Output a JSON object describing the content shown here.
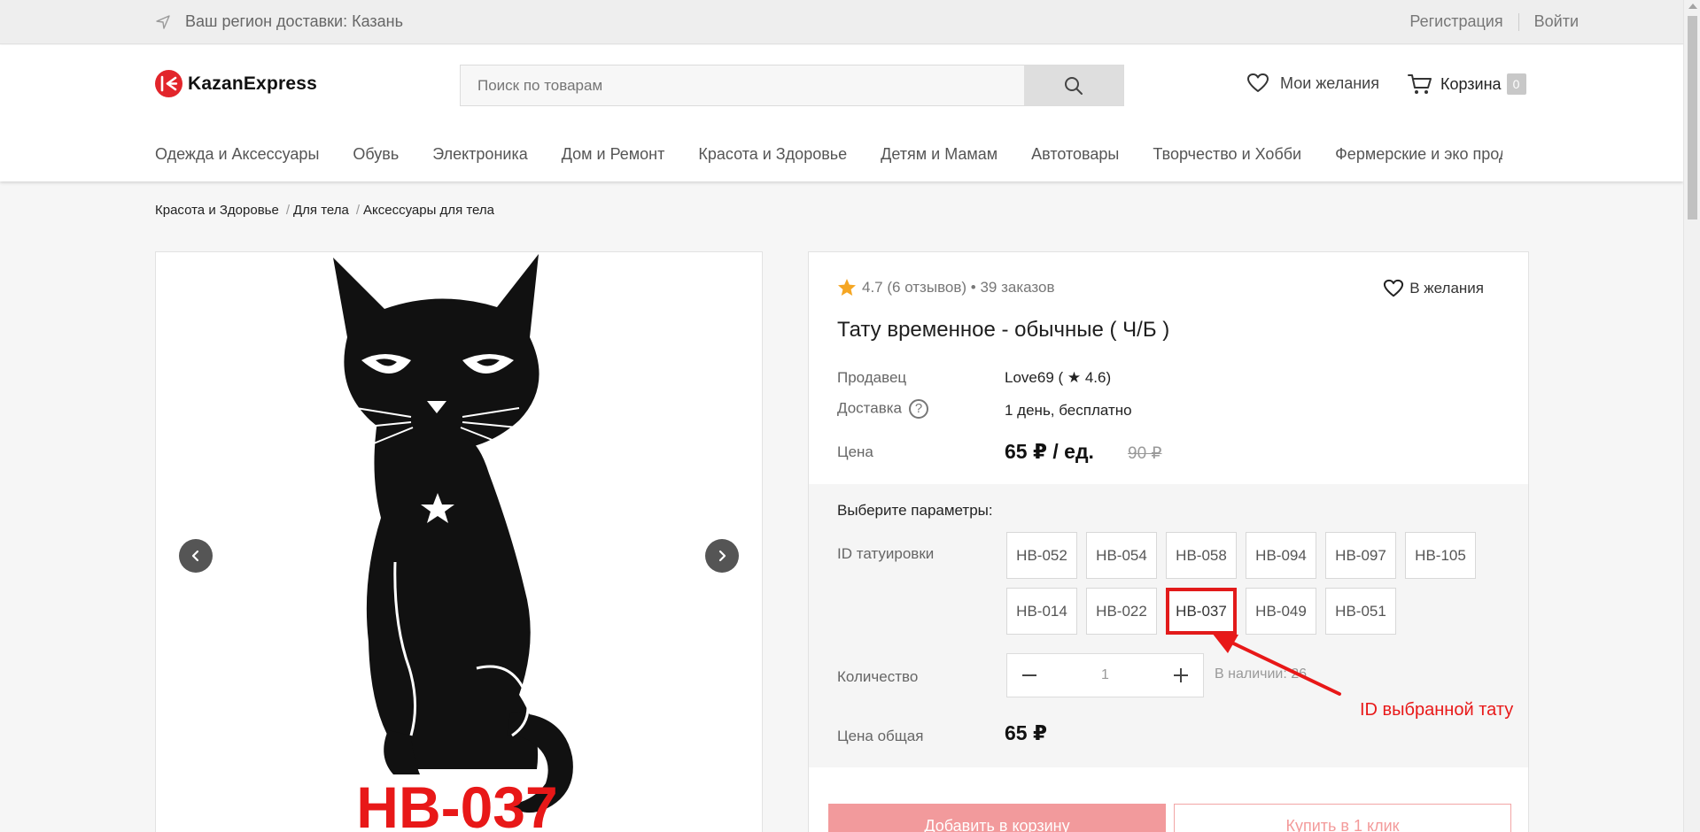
{
  "topbar": {
    "region_text": "Ваш регион доставки: Казань",
    "register": "Регистрация",
    "login": "Войти"
  },
  "header": {
    "logo_text": "KazanExpress",
    "search_placeholder": "Поиск по товарам",
    "wishlist": "Мои желания",
    "cart": "Корзина",
    "cart_count": "0"
  },
  "nav": [
    "Одежда и Аксессуары",
    "Обувь",
    "Электроника",
    "Дом и Ремонт",
    "Красота и Здоровье",
    "Детям и Мамам",
    "Автотовары",
    "Творчество и Хобби",
    "Фермерские и эко проду"
  ],
  "breadcrumb": [
    "Красота и Здоровье",
    "Для тела",
    "Аксессуары для тела"
  ],
  "gallery": {
    "image_caption": "HB-037"
  },
  "product": {
    "rating": "4.7 (6 отзывов) • 39 заказов",
    "wish_button": "В желания",
    "title": "Тату временное - обычные ( Ч/Б )",
    "seller_label": "Продавец",
    "seller_value": "Love69 ( ★ 4.6)",
    "delivery_label": "Доставка",
    "delivery_value": "1 день, бесплатно",
    "price_label": "Цена",
    "price": "65 ₽ / ед.",
    "old_price": "90 ₽"
  },
  "params": {
    "heading": "Выберите параметры:",
    "id_label": "ID татуировки",
    "options": [
      "HB-052",
      "HB-054",
      "HB-058",
      "HB-094",
      "HB-097",
      "HB-105",
      "HB-014",
      "HB-022",
      "HB-037",
      "HB-049",
      "HB-051"
    ],
    "selected": "HB-037",
    "qty_label": "Количество",
    "qty_value": "1",
    "stock": "В наличии: 26",
    "total_label": "Цена общая",
    "total": "65 ₽"
  },
  "actions": {
    "add_to_cart": "Добавить в корзину",
    "buy_one_click": "Купить в 1 клик"
  },
  "annotation": {
    "text": "ID выбранной тату",
    "color": "#e81818"
  },
  "colors": {
    "brand": "#e2252b",
    "selected_border": "#e21a1a",
    "star": "#f5a623"
  }
}
